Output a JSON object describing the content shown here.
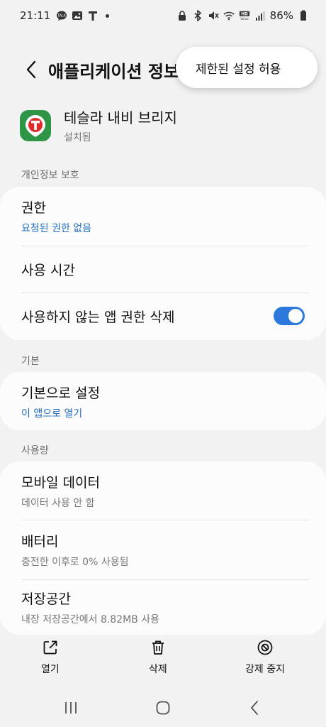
{
  "status_bar": {
    "time": "21:11",
    "left_icons": [
      "talk-icon",
      "image-icon",
      "t-icon",
      "dot-icon"
    ],
    "right_icons": [
      "lock-icon",
      "bluetooth-icon",
      "mute-icon",
      "wifi-icon",
      "hd-voice-icon",
      "signal-icon",
      "battery-icon"
    ],
    "battery": "86%"
  },
  "header": {
    "title": "애플리케이션 정보"
  },
  "popup_menu": {
    "item": "제한된 설정 허용"
  },
  "app": {
    "name": "테슬라 내비 브리지",
    "status": "설치됨",
    "icon_color": "#2e9446"
  },
  "sections": {
    "privacy_label": "개인정보 보호",
    "basic_label": "기본",
    "usage_label": "사용량"
  },
  "privacy": {
    "permissions_title": "권한",
    "permissions_sub": "요청된 권한 없음",
    "screen_time_title": "사용 시간",
    "remove_perms_title": "사용하지 않는 앱 권한 삭제",
    "remove_perms_enabled": true
  },
  "basic": {
    "default_title": "기본으로 설정",
    "default_sub": "이 앱으로 열기"
  },
  "usage": {
    "mobile_data_title": "모바일 데이터",
    "mobile_data_sub": "데이터 사용 안 함",
    "battery_title": "배터리",
    "battery_sub": "충전한 이후로 0% 사용됨",
    "storage_title": "저장공간",
    "storage_sub": "내장 저장공간에서 8.82MB 사용"
  },
  "actions": {
    "open": "열기",
    "uninstall": "삭제",
    "force_stop": "강제 중지"
  },
  "colors": {
    "accent": "#2b79dd",
    "link": "#1f6dc2",
    "background": "#f2f2f2"
  }
}
